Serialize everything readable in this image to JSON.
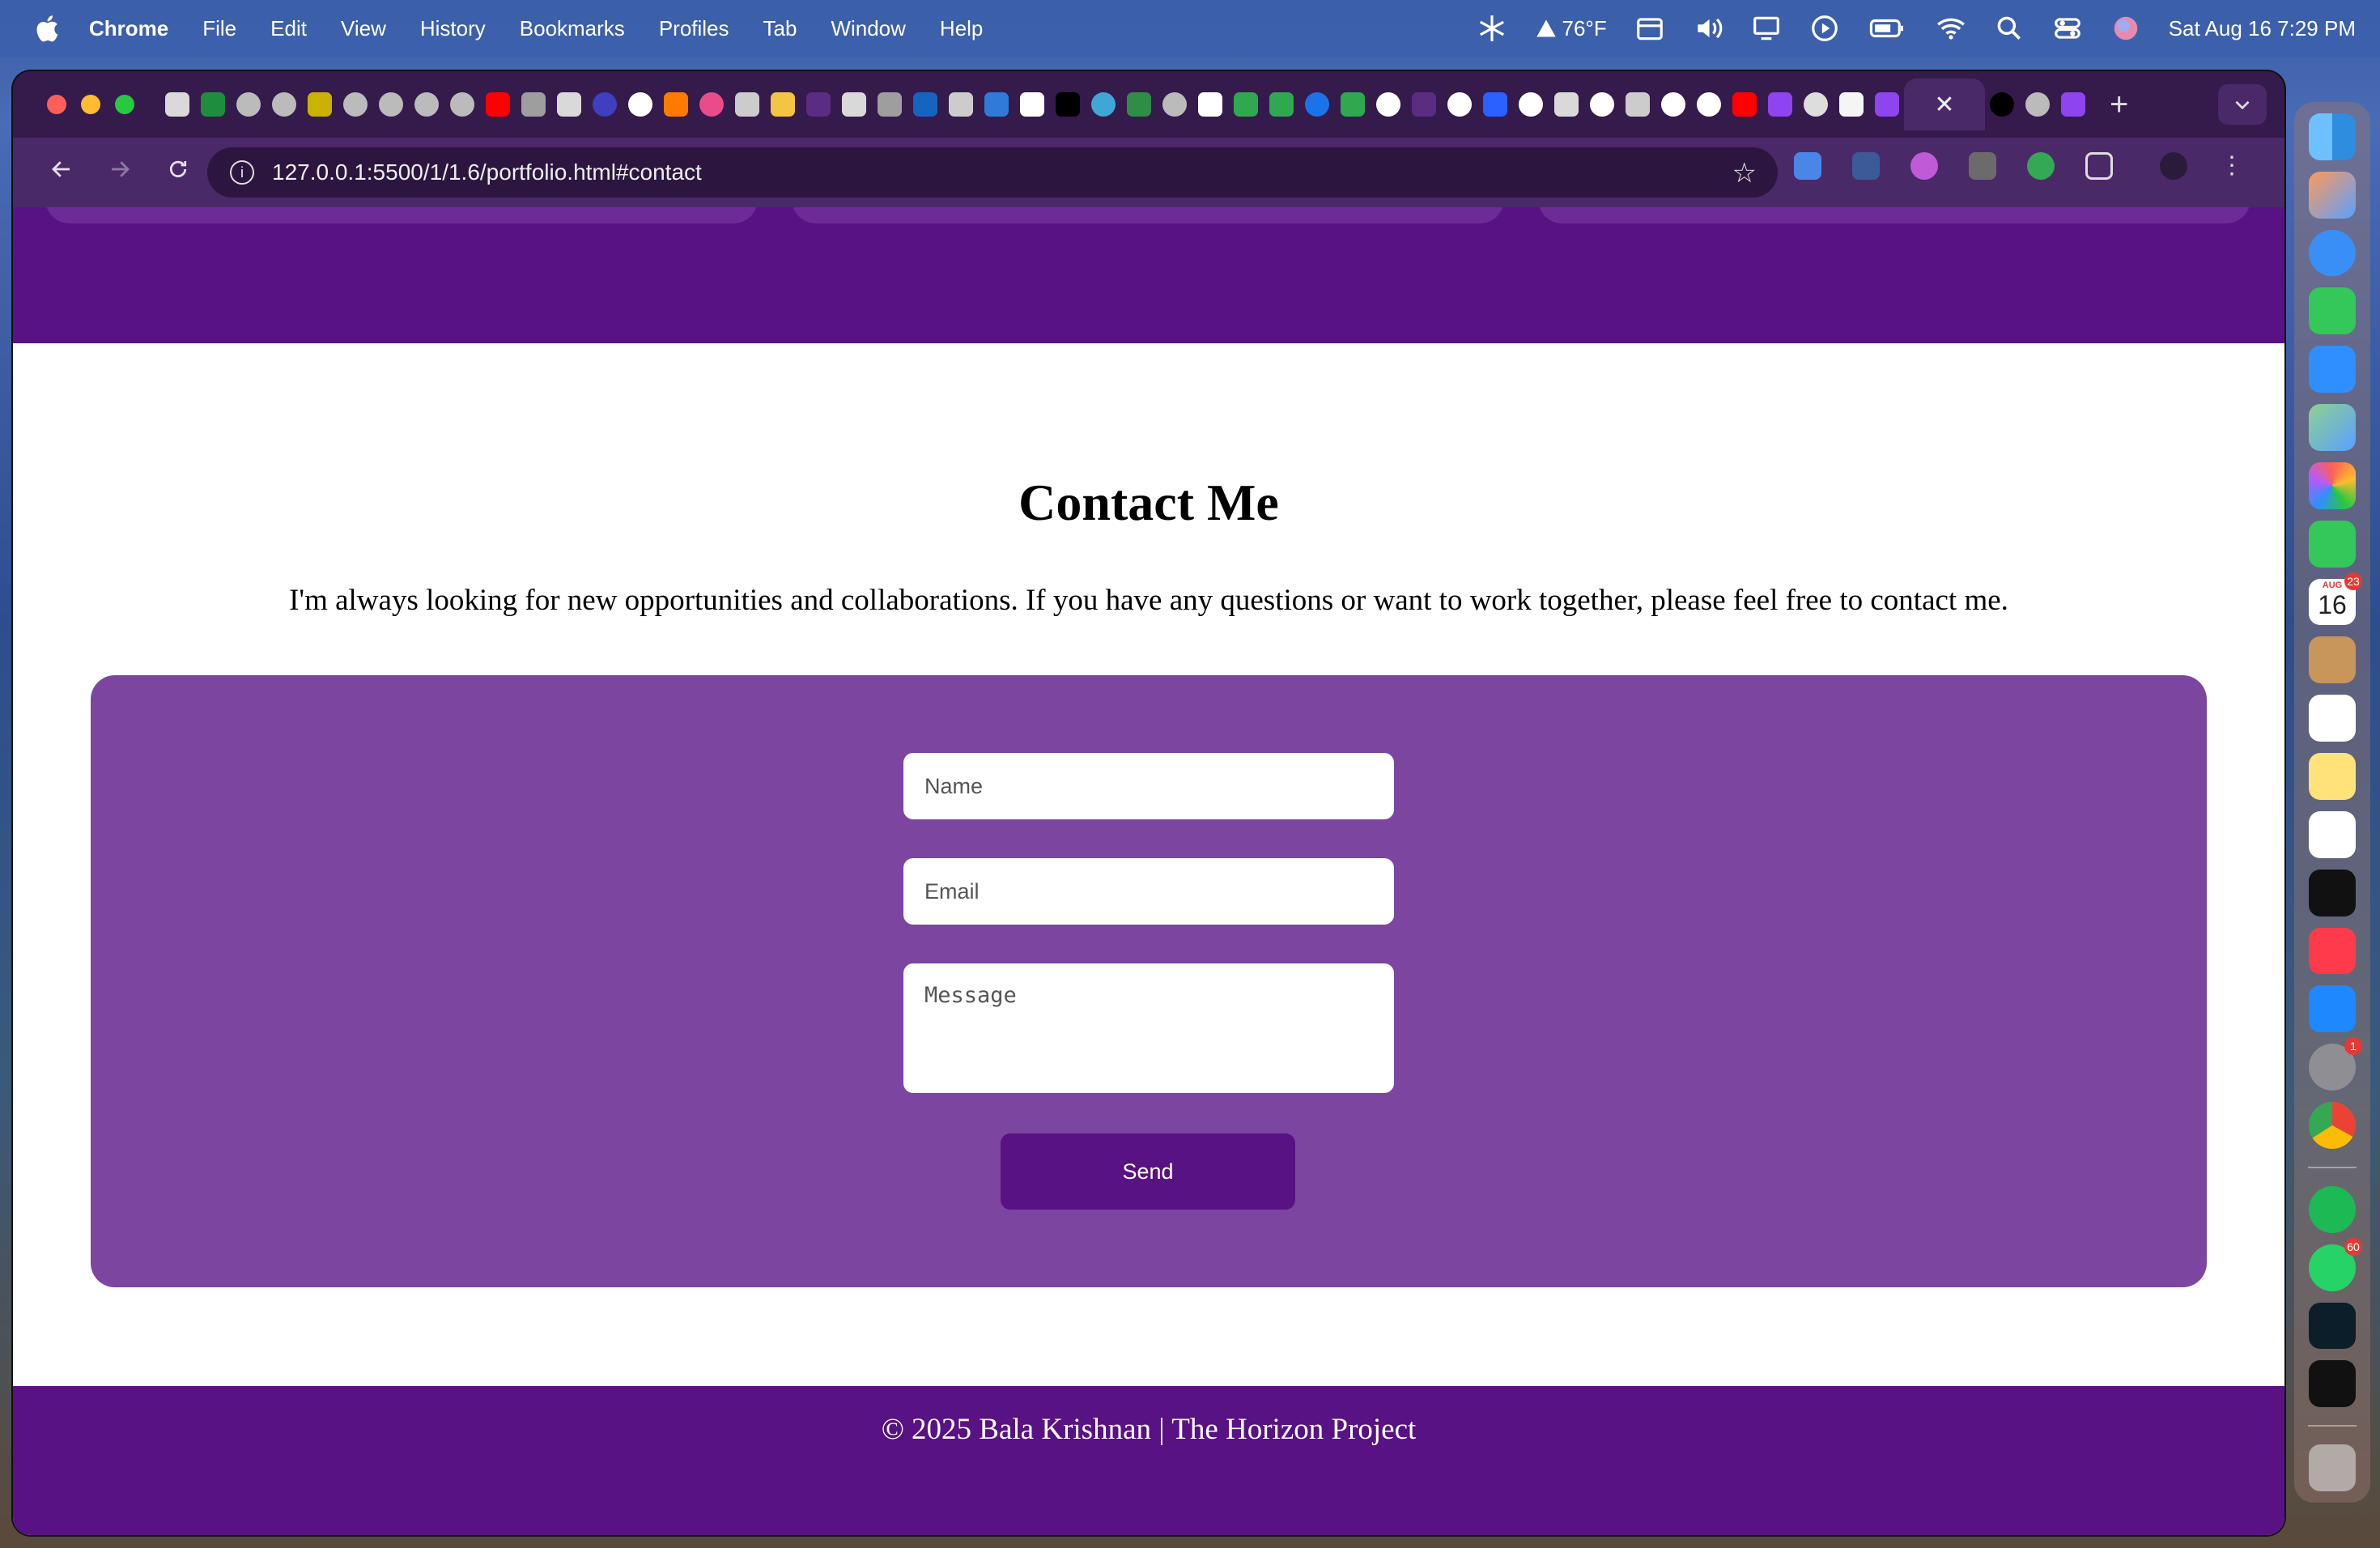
{
  "menubar": {
    "app_name": "Chrome",
    "menus": [
      "File",
      "Edit",
      "View",
      "History",
      "Bookmarks",
      "Profiles",
      "Tab",
      "Window",
      "Help"
    ],
    "weather": "76°F",
    "datetime": "Sat Aug 16  7:29 PM"
  },
  "browser": {
    "active_tab_close": "✕",
    "new_tab": "+",
    "url": "127.0.0.1:5500/1/1.6/portfolio.html#contact"
  },
  "page": {
    "contact": {
      "title": "Contact Me",
      "intro": "I'm always looking for new opportunities and collaborations. If you have any questions or want to work together, please feel free to contact me.",
      "name_placeholder": "Name",
      "email_placeholder": "Email",
      "message_placeholder": "Message",
      "send_label": "Send"
    },
    "footer": "© 2025 Bala Krishnan | The Horizon Project"
  },
  "dock": {
    "calendar_month": "AUG",
    "calendar_day": "16",
    "calendar_badge": "23",
    "settings_badge": "1",
    "whatsapp_badge": "60"
  },
  "colors": {
    "brand_purple": "#581283",
    "form_purple": "#7c46a0"
  }
}
